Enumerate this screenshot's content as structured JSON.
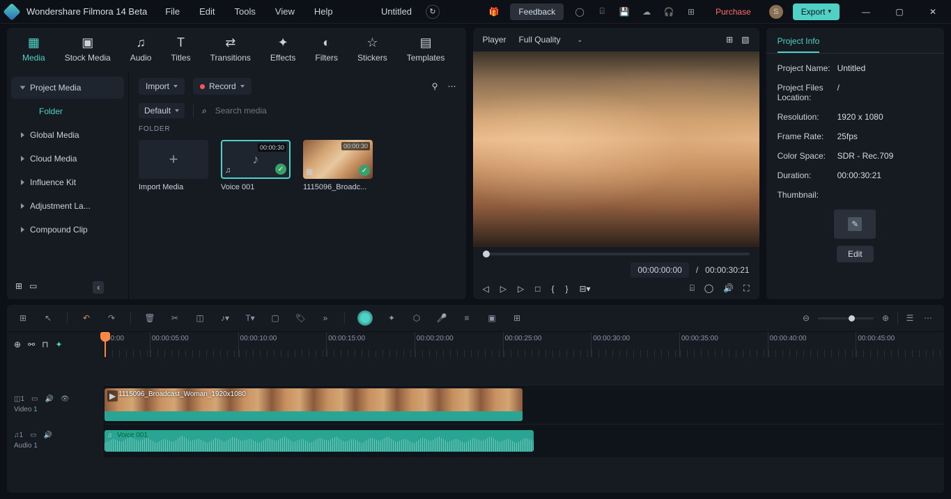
{
  "app": {
    "name": "Wondershare Filmora 14 Beta",
    "doc": "Untitled"
  },
  "menu": [
    "File",
    "Edit",
    "Tools",
    "View",
    "Help"
  ],
  "header": {
    "feedback": "Feedback",
    "purchase": "Purchase",
    "export": "Export",
    "user_initial": "S"
  },
  "tabs": [
    {
      "id": "media",
      "label": "Media"
    },
    {
      "id": "stock",
      "label": "Stock Media"
    },
    {
      "id": "audio",
      "label": "Audio"
    },
    {
      "id": "titles",
      "label": "Titles"
    },
    {
      "id": "transitions",
      "label": "Transitions"
    },
    {
      "id": "effects",
      "label": "Effects"
    },
    {
      "id": "filters",
      "label": "Filters"
    },
    {
      "id": "stickers",
      "label": "Stickers"
    },
    {
      "id": "templates",
      "label": "Templates"
    }
  ],
  "sidebar": {
    "items": [
      "Project Media",
      "Folder",
      "Global Media",
      "Cloud Media",
      "Influence Kit",
      "Adjustment La...",
      "Compound Clip"
    ]
  },
  "controls": {
    "import": "Import",
    "record": "Record",
    "default": "Default",
    "search_placeholder": "Search media",
    "folder_label": "FOLDER"
  },
  "thumbs": [
    {
      "label": "Import Media",
      "type": "import"
    },
    {
      "label": "Voice 001",
      "type": "audio",
      "dur": "00:00:30"
    },
    {
      "label": "1115096_Broadc...",
      "type": "video",
      "dur": "00:00:30"
    }
  ],
  "player": {
    "label": "Player",
    "quality": "Full Quality",
    "time_current": "00:00:00:00",
    "time_total": "00:00:30:21"
  },
  "info": {
    "tab": "Project Info",
    "rows": {
      "project_name_k": "Project Name:",
      "project_name_v": "Untitled",
      "location_k": "Project Files Location:",
      "location_v": "/",
      "resolution_k": "Resolution:",
      "resolution_v": "1920 x 1080",
      "framerate_k": "Frame Rate:",
      "framerate_v": "25fps",
      "colorspace_k": "Color Space:",
      "colorspace_v": "SDR - Rec.709",
      "duration_k": "Duration:",
      "duration_v": "00:00:30:21",
      "thumbnail_k": "Thumbnail:"
    },
    "edit": "Edit"
  },
  "timeline": {
    "start": "00:00",
    "ticks": [
      "00:00:05:00",
      "00:00:10:00",
      "00:00:15:00",
      "00:00:20:00",
      "00:00:25:00",
      "00:00:30:00",
      "00:00:35:00",
      "00:00:40:00",
      "00:00:45:00"
    ],
    "tracks": {
      "video": {
        "name": "Video 1",
        "clip": "1115096_Broadcast_Woman_1920x1080"
      },
      "audio": {
        "name": "Audio 1",
        "clip": "Voice 001"
      }
    }
  }
}
